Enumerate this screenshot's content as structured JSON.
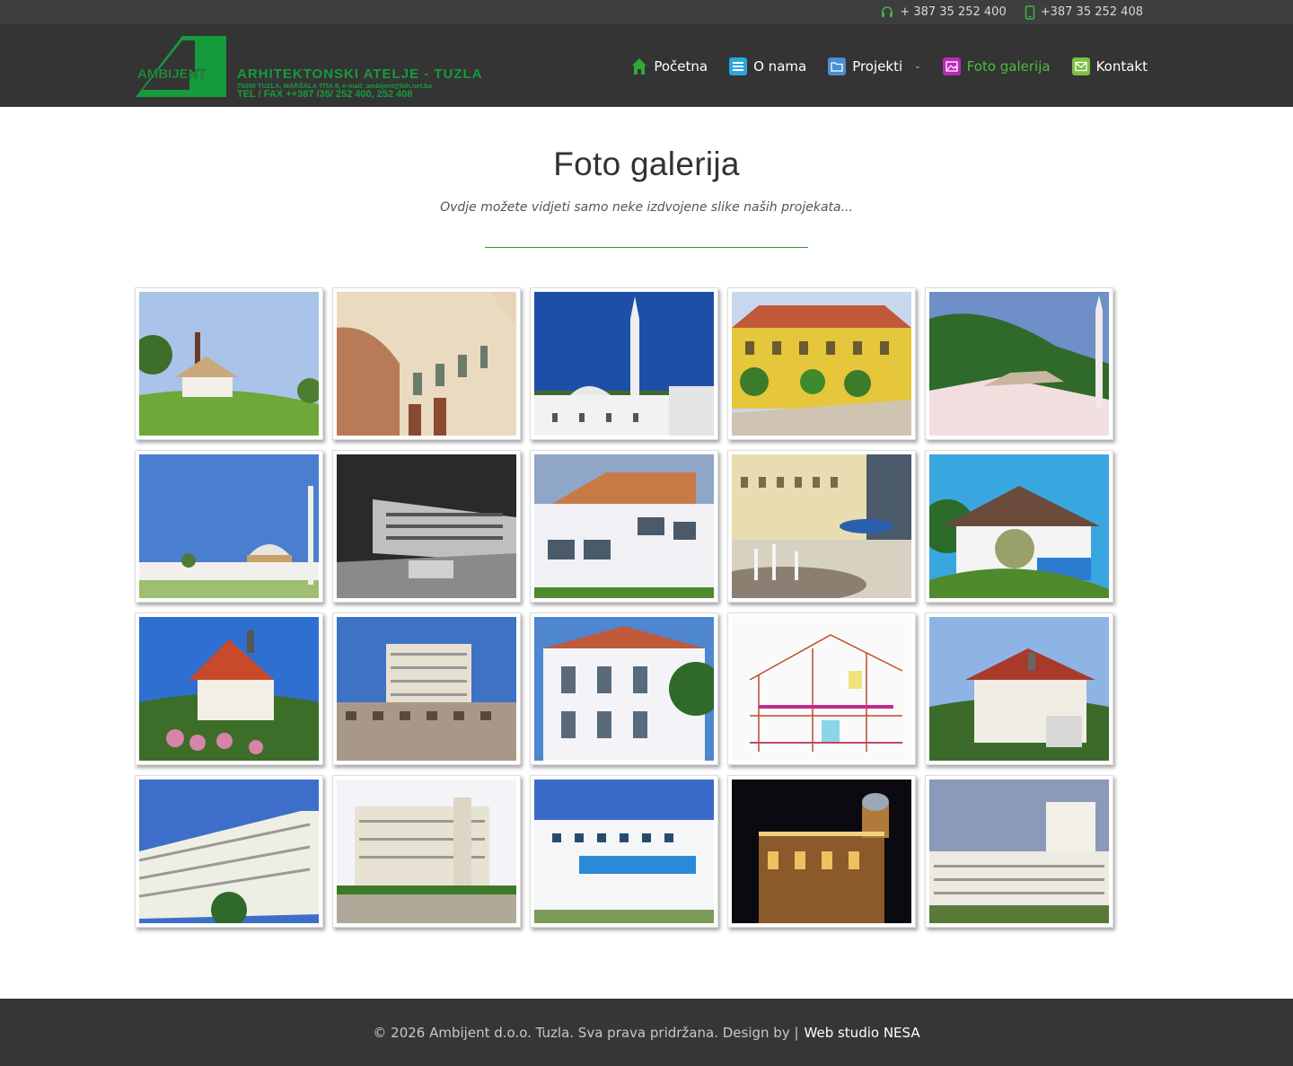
{
  "topbar": {
    "phone1": "+ 387 35 252 400",
    "phone1_icon": "headset-icon",
    "phone2": "+387 35 252 408",
    "phone2_icon": "mobile-phone-icon"
  },
  "logo": {
    "name": "AMBIJENT",
    "tagline": "ARHITEKTONSKI ATELJE - TUZLA",
    "address": "75000 TUZLA, MARŠALA TITA 8, e-mail: ambijent@bih.net.ba",
    "telfax": "TEL / FAX ++387 /35/ 252 400, 252 408"
  },
  "nav": {
    "items": [
      {
        "label": "Početna",
        "icon": "home-icon",
        "color": "#2fa83c"
      },
      {
        "label": "O nama",
        "icon": "document-icon",
        "color": "#2aa7e0"
      },
      {
        "label": "Projekti",
        "icon": "folder-icon",
        "color": "#4a8fd0"
      },
      {
        "label": "Foto galerija",
        "icon": "image-icon",
        "color": "#b72bb8",
        "active": true
      },
      {
        "label": "Kontakt",
        "icon": "mail-icon",
        "color": "#7cc043"
      }
    ],
    "active_color": "#4cbb3c"
  },
  "page": {
    "title": "Foto galerija",
    "subtitle": "Ovdje možete vidjeti samo neke izdvojene slike naših projekata..."
  },
  "gallery": {
    "count": 20
  },
  "footer": {
    "text": "© 2026 Ambijent d.o.o. Tuzla. Sva prava pridržana. Design by |",
    "link": "Web studio NESA"
  }
}
